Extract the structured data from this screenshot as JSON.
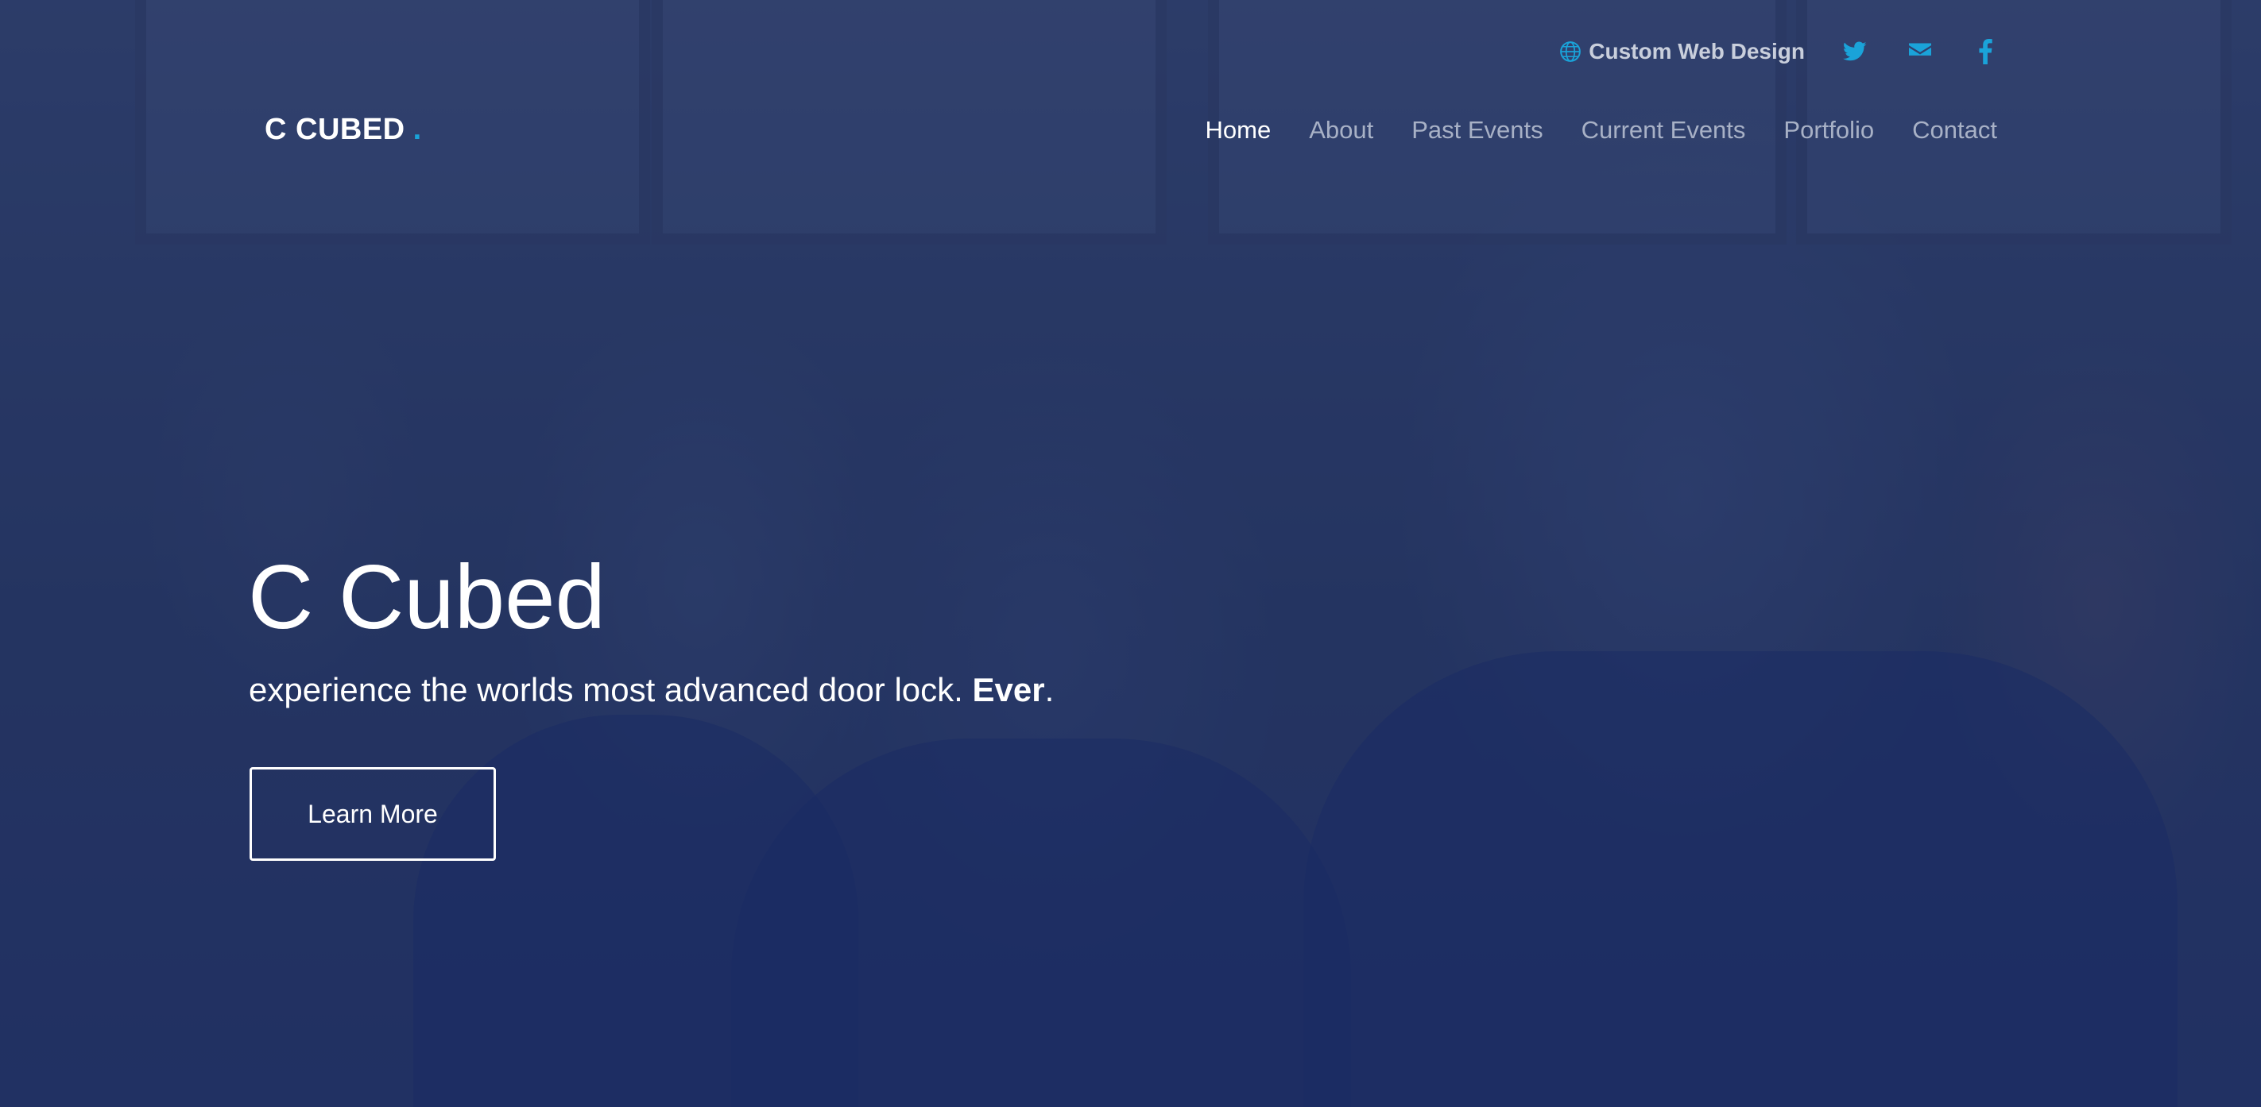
{
  "top_bar": {
    "site_link_label": "Custom Web Design",
    "social_icons": [
      "twitter-icon",
      "mail-icon",
      "facebook-icon"
    ],
    "icon_color": "#1aa3d9"
  },
  "nav": {
    "logo_text": "C CUBED",
    "logo_dot": ".",
    "logo_dot_color": "#1aa3d9",
    "items": [
      {
        "label": "Home",
        "active": true
      },
      {
        "label": "About",
        "active": false
      },
      {
        "label": "Past Events",
        "active": false
      },
      {
        "label": "Current Events",
        "active": false
      },
      {
        "label": "Portfolio",
        "active": false
      },
      {
        "label": "Contact",
        "active": false
      }
    ]
  },
  "hero": {
    "title": "C Cubed",
    "subtitle_prefix": "experience the worlds most advanced door lock. ",
    "subtitle_bold": "Ever",
    "subtitle_suffix": ".",
    "cta_label": "Learn More",
    "overlay_color": "#1f2d5c"
  }
}
